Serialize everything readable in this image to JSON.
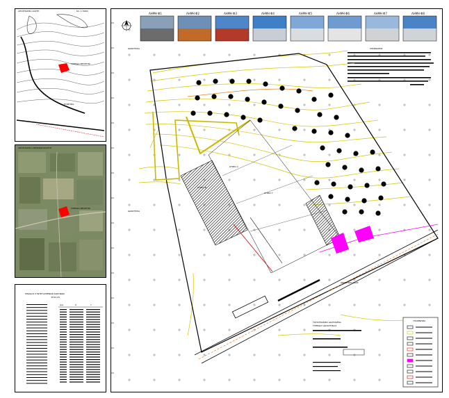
{
  "topo_panel": {
    "title": "ΑΠΟΣΠΑΣΜΑ ΧΑΡΤΗ",
    "scale": "ΚΛ. 1:5000",
    "area_label": "ΓΗΠΕΔΟ ΜΕΛΕΤΗΣ",
    "place_label": "ΠΟΝΤΙΚΙΑ"
  },
  "ortho_panel": {
    "title": "ΑΠΟΣΠΑΣΜΑ ΟΡΘΟΦΩΤΟΧΑΡΤΗ",
    "area_label": "ΓΗΠΕΔΟ ΜΕΛΕΤΗΣ"
  },
  "coord_table": {
    "title": "ΠΙΝΑΚΑΣ ΣΥΝΤΕΤΑΓΜΕΝΩΝ ΚΟΡΥΦΩΝ",
    "subtitle": "ΕΓΣΑ 87",
    "headers": [
      "Α/Α",
      "X",
      "Y"
    ],
    "row_count_note": ""
  },
  "photos": [
    {
      "label": "ΛΗΨΗ Φ1",
      "tone": "building-grey"
    },
    {
      "label": "ΛΗΨΗ Φ2",
      "tone": "building-orange"
    },
    {
      "label": "ΛΗΨΗ Φ3",
      "tone": "building-blue-red"
    },
    {
      "label": "ΛΗΨΗ Φ4",
      "tone": "hangar-blue"
    },
    {
      "label": "ΛΗΨΗ Φ5",
      "tone": "building-white"
    },
    {
      "label": "ΛΗΨΗ Φ6",
      "tone": "roof-white"
    },
    {
      "label": "ΛΗΨΗ Φ7",
      "tone": "wall-white"
    },
    {
      "label": "ΛΗΨΗ Φ8",
      "tone": "building-blue"
    }
  ],
  "plan": {
    "north_label": "Β",
    "notes_title": "ΣΗΜΕΙΩΣΕΙΣ",
    "building_a": "ΚΤΙΡΙΟ Α",
    "building_b": "ΚΤΙΡΙΟ Β",
    "building_c": "ΚΤΙΡΙΟ Γ",
    "road_label": "ΔΗΜΟΤΙΚΗ ΟΔΟΣ",
    "field_left": "ΙΔΙΟΚΤΗΣΙΑ",
    "field_top": "ΙΔΙΟΚΤΗΣΙΑ"
  },
  "title_block": {
    "heading": "ΤΟΠΟΓΡΑΦΙΚΟ ΔΙΑΓΡΑΜΜΑ",
    "subheading": "ΓΗΠΕΔΟΥ ΙΔΙΟΚΤΗΣΙΑΣ"
  },
  "legend": {
    "title": "ΥΠΟΜΝΗΜΑ",
    "items": [
      "",
      "",
      "",
      "",
      "",
      "",
      "",
      "",
      "",
      "",
      ""
    ]
  },
  "colors": {
    "contour": "#d4c400",
    "boundary": "#000000",
    "parcel_red": "#ff0000",
    "magenta": "#ff00ff",
    "orange_line": "#e07000",
    "grid_cross": "#555555"
  }
}
